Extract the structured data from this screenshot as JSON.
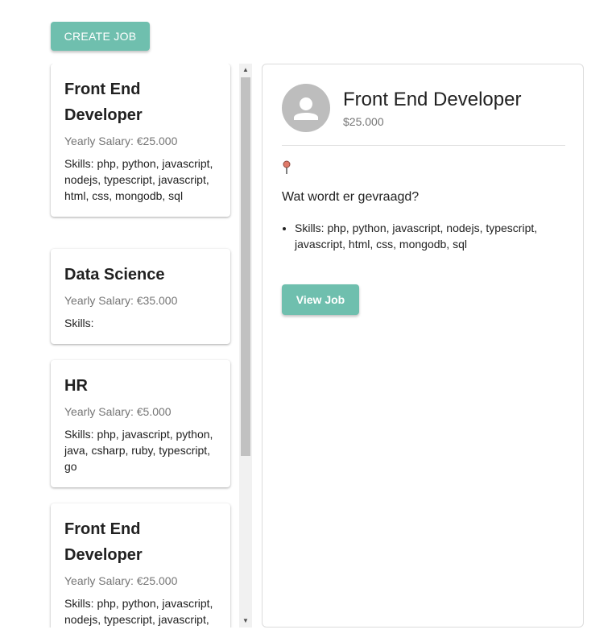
{
  "toolbar": {
    "create_label": "CREATE JOB"
  },
  "jobs": [
    {
      "title": "Front End Developer",
      "salary": "Yearly Salary: €25.000",
      "skills": "Skills: php, python, javascript, nodejs, typescript, javascript, html, css, mongodb, sql"
    },
    {
      "title": "Data Science",
      "salary": "Yearly Salary: €35.000",
      "skills": "Skills:"
    },
    {
      "title": "HR",
      "salary": "Yearly Salary: €5.000",
      "skills": "Skills: php, javascript, python, java, csharp, ruby, typescript, go"
    },
    {
      "title": "Front End Developer",
      "salary": "Yearly Salary: €25.000",
      "skills": "Skills: php, python, javascript, nodejs, typescript, javascript, html, css, mongodb, sql"
    }
  ],
  "detail": {
    "title": "Front End Developer",
    "salary": "$25.000",
    "question": "Wat wordt er gevraagd?",
    "skills": "Skills: php, python, javascript, nodejs, typescript, javascript, html, css, mongodb, sql",
    "view_label": "View Job",
    "location_icon": "map-pin-icon",
    "avatar_icon": "person-icon"
  },
  "colors": {
    "accent": "#6fbfae",
    "avatar_bg": "#bdbdbd",
    "muted_text": "#757575",
    "pin": "#e07a6a"
  }
}
